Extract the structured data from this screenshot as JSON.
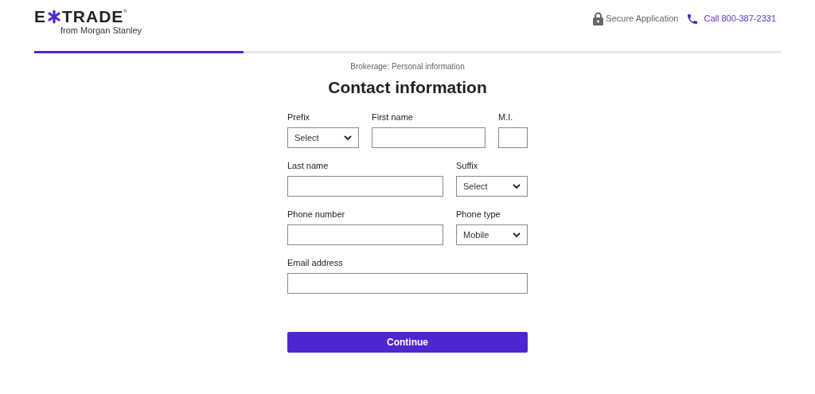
{
  "header": {
    "logo": {
      "left": "E",
      "right": "TRADE",
      "mark": "®",
      "subtitle": "from Morgan Stanley"
    },
    "secure": "Secure Application",
    "call": "Call 800-387-2331"
  },
  "progress": {
    "level": 0.28
  },
  "breadcrumb": "Brokerage: Personal information",
  "title": "Contact information",
  "rows": [
    [
      {
        "kind": "select",
        "label": "Prefix",
        "value": "Select"
      },
      {
        "kind": "text",
        "label": "First name"
      },
      {
        "kind": "text",
        "label": "M.I."
      }
    ],
    [
      {
        "kind": "text",
        "label": "Last name"
      },
      {
        "kind": "select",
        "label": "Suffix",
        "value": "Select"
      }
    ],
    [
      {
        "kind": "text",
        "label": "Phone number"
      },
      {
        "kind": "select",
        "label": "Phone type",
        "value": "Mobile"
      }
    ],
    [
      {
        "kind": "text",
        "label": "Email address"
      }
    ]
  ],
  "button": "Continue"
}
